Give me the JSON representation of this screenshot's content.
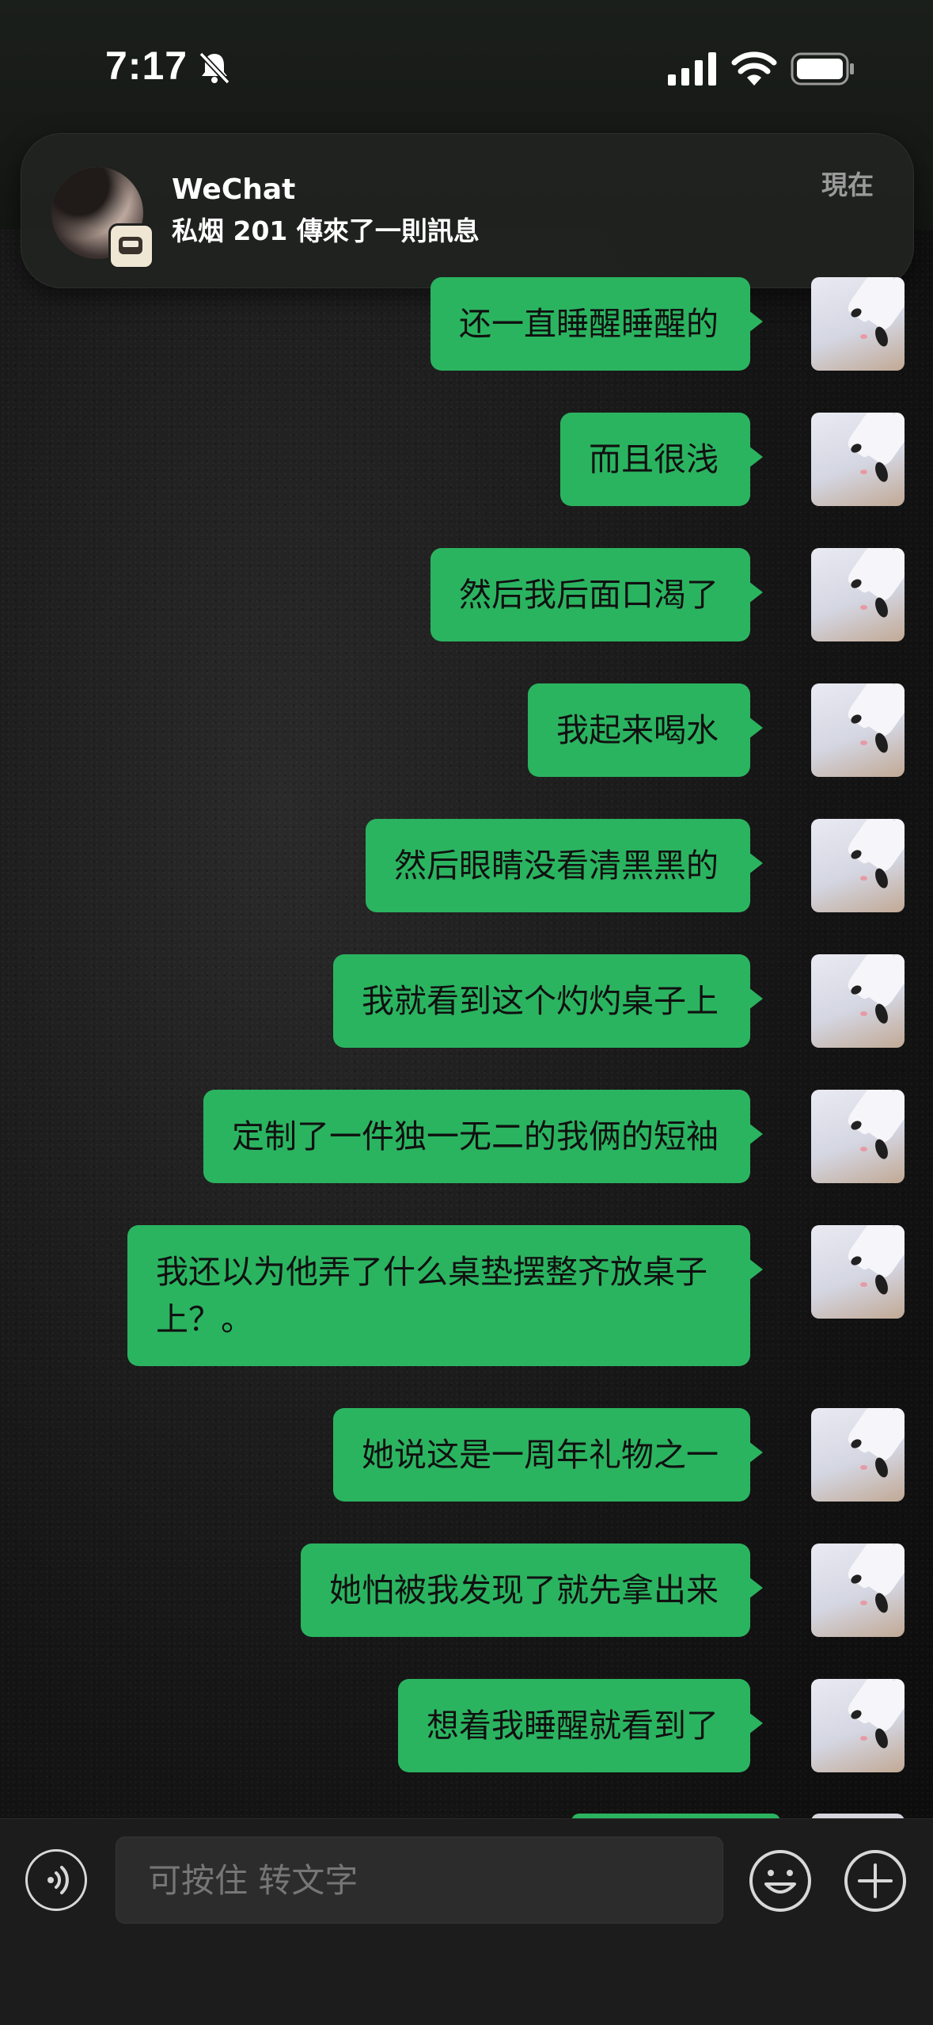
{
  "status_bar": {
    "time": "7:17"
  },
  "notification": {
    "app": "WeChat",
    "message": "私烟 201 傳來了一則訊息",
    "time": "現在"
  },
  "messages": [
    {
      "text": "还一直睡醒睡醒的"
    },
    {
      "text": "而且很浅"
    },
    {
      "text": "然后我后面口渴了"
    },
    {
      "text": "我起来喝水"
    },
    {
      "text": "然后眼睛没看清黑黑的"
    },
    {
      "text": "我就看到这个灼灼桌子上"
    },
    {
      "text": "定制了一件独一无二的我俩的短袖"
    },
    {
      "text": "我还以为他弄了什么桌垫摆整齐放桌子上？。"
    },
    {
      "text": "她说这是一周年礼物之一"
    },
    {
      "text": "她怕被我发现了就先拿出来"
    },
    {
      "text": "想着我睡醒就看到了"
    }
  ],
  "input_bar": {
    "placeholder": "可按住 转文字"
  },
  "colors": {
    "bubble": "#2bb460",
    "background": "#151515"
  },
  "icons": [
    "bell-slash-icon",
    "signal-icon",
    "wifi-icon",
    "battery-icon",
    "voice-icon",
    "emoji-icon",
    "plus-icon"
  ]
}
